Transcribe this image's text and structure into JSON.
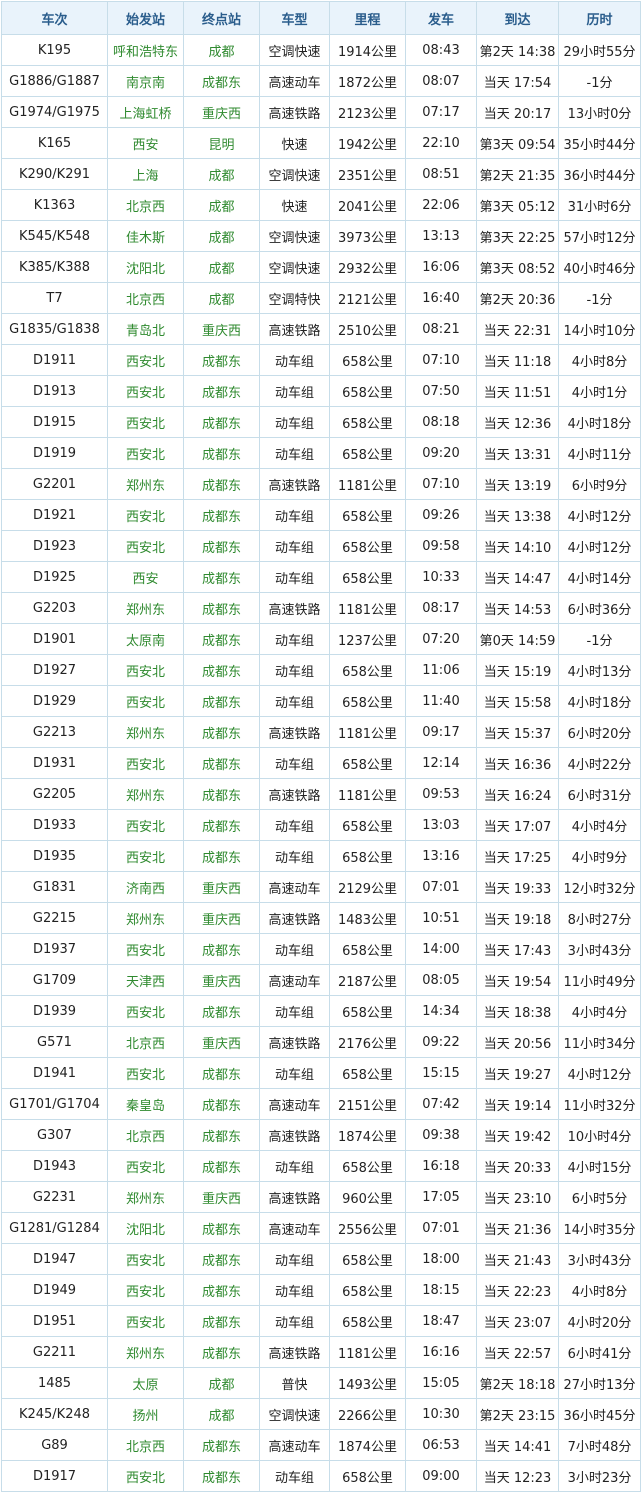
{
  "table": {
    "headers": [
      "车次",
      "始发站",
      "终点站",
      "车型",
      "里程",
      "发车",
      "到达",
      "历时"
    ],
    "rows": [
      [
        "K195",
        "呼和浩特东",
        "成都",
        "空调快速",
        "1914公里",
        "08:43",
        "第2天 14:38",
        "29小时55分"
      ],
      [
        "G1886/G1887",
        "南京南",
        "成都东",
        "高速动车",
        "1872公里",
        "08:07",
        "当天 17:54",
        "-1分"
      ],
      [
        "G1974/G1975",
        "上海虹桥",
        "重庆西",
        "高速铁路",
        "2123公里",
        "07:17",
        "当天 20:17",
        "13小时0分"
      ],
      [
        "K165",
        "西安",
        "昆明",
        "快速",
        "1942公里",
        "22:10",
        "第3天 09:54",
        "35小时44分"
      ],
      [
        "K290/K291",
        "上海",
        "成都",
        "空调快速",
        "2351公里",
        "08:51",
        "第2天 21:35",
        "36小时44分"
      ],
      [
        "K1363",
        "北京西",
        "成都",
        "快速",
        "2041公里",
        "22:06",
        "第3天 05:12",
        "31小时6分"
      ],
      [
        "K545/K548",
        "佳木斯",
        "成都",
        "空调快速",
        "3973公里",
        "13:13",
        "第3天 22:25",
        "57小时12分"
      ],
      [
        "K385/K388",
        "沈阳北",
        "成都",
        "空调快速",
        "2932公里",
        "16:06",
        "第3天 08:52",
        "40小时46分"
      ],
      [
        "T7",
        "北京西",
        "成都",
        "空调特快",
        "2121公里",
        "16:40",
        "第2天 20:36",
        "-1分"
      ],
      [
        "G1835/G1838",
        "青岛北",
        "重庆西",
        "高速铁路",
        "2510公里",
        "08:21",
        "当天 22:31",
        "14小时10分"
      ],
      [
        "D1911",
        "西安北",
        "成都东",
        "动车组",
        "658公里",
        "07:10",
        "当天 11:18",
        "4小时8分"
      ],
      [
        "D1913",
        "西安北",
        "成都东",
        "动车组",
        "658公里",
        "07:50",
        "当天 11:51",
        "4小时1分"
      ],
      [
        "D1915",
        "西安北",
        "成都东",
        "动车组",
        "658公里",
        "08:18",
        "当天 12:36",
        "4小时18分"
      ],
      [
        "D1919",
        "西安北",
        "成都东",
        "动车组",
        "658公里",
        "09:20",
        "当天 13:31",
        "4小时11分"
      ],
      [
        "G2201",
        "郑州东",
        "成都东",
        "高速铁路",
        "1181公里",
        "07:10",
        "当天 13:19",
        "6小时9分"
      ],
      [
        "D1921",
        "西安北",
        "成都东",
        "动车组",
        "658公里",
        "09:26",
        "当天 13:38",
        "4小时12分"
      ],
      [
        "D1923",
        "西安北",
        "成都东",
        "动车组",
        "658公里",
        "09:58",
        "当天 14:10",
        "4小时12分"
      ],
      [
        "D1925",
        "西安",
        "成都东",
        "动车组",
        "658公里",
        "10:33",
        "当天 14:47",
        "4小时14分"
      ],
      [
        "G2203",
        "郑州东",
        "成都东",
        "高速铁路",
        "1181公里",
        "08:17",
        "当天 14:53",
        "6小时36分"
      ],
      [
        "D1901",
        "太原南",
        "成都东",
        "动车组",
        "1237公里",
        "07:20",
        "第0天 14:59",
        "-1分"
      ],
      [
        "D1927",
        "西安北",
        "成都东",
        "动车组",
        "658公里",
        "11:06",
        "当天 15:19",
        "4小时13分"
      ],
      [
        "D1929",
        "西安北",
        "成都东",
        "动车组",
        "658公里",
        "11:40",
        "当天 15:58",
        "4小时18分"
      ],
      [
        "G2213",
        "郑州东",
        "成都东",
        "高速铁路",
        "1181公里",
        "09:17",
        "当天 15:37",
        "6小时20分"
      ],
      [
        "D1931",
        "西安北",
        "成都东",
        "动车组",
        "658公里",
        "12:14",
        "当天 16:36",
        "4小时22分"
      ],
      [
        "G2205",
        "郑州东",
        "成都东",
        "高速铁路",
        "1181公里",
        "09:53",
        "当天 16:24",
        "6小时31分"
      ],
      [
        "D1933",
        "西安北",
        "成都东",
        "动车组",
        "658公里",
        "13:03",
        "当天 17:07",
        "4小时4分"
      ],
      [
        "D1935",
        "西安北",
        "成都东",
        "动车组",
        "658公里",
        "13:16",
        "当天 17:25",
        "4小时9分"
      ],
      [
        "G1831",
        "济南西",
        "重庆西",
        "高速动车",
        "2129公里",
        "07:01",
        "当天 19:33",
        "12小时32分"
      ],
      [
        "G2215",
        "郑州东",
        "重庆西",
        "高速铁路",
        "1483公里",
        "10:51",
        "当天 19:18",
        "8小时27分"
      ],
      [
        "D1937",
        "西安北",
        "成都东",
        "动车组",
        "658公里",
        "14:00",
        "当天 17:43",
        "3小时43分"
      ],
      [
        "G1709",
        "天津西",
        "重庆西",
        "高速动车",
        "2187公里",
        "08:05",
        "当天 19:54",
        "11小时49分"
      ],
      [
        "D1939",
        "西安北",
        "成都东",
        "动车组",
        "658公里",
        "14:34",
        "当天 18:38",
        "4小时4分"
      ],
      [
        "G571",
        "北京西",
        "重庆西",
        "高速铁路",
        "2176公里",
        "09:22",
        "当天 20:56",
        "11小时34分"
      ],
      [
        "D1941",
        "西安北",
        "成都东",
        "动车组",
        "658公里",
        "15:15",
        "当天 19:27",
        "4小时12分"
      ],
      [
        "G1701/G1704",
        "秦皇岛",
        "成都东",
        "高速动车",
        "2151公里",
        "07:42",
        "当天 19:14",
        "11小时32分"
      ],
      [
        "G307",
        "北京西",
        "成都东",
        "高速铁路",
        "1874公里",
        "09:38",
        "当天 19:42",
        "10小时4分"
      ],
      [
        "D1943",
        "西安北",
        "成都东",
        "动车组",
        "658公里",
        "16:18",
        "当天 20:33",
        "4小时15分"
      ],
      [
        "G2231",
        "郑州东",
        "重庆西",
        "高速铁路",
        "960公里",
        "17:05",
        "当天 23:10",
        "6小时5分"
      ],
      [
        "G1281/G1284",
        "沈阳北",
        "成都东",
        "高速动车",
        "2556公里",
        "07:01",
        "当天 21:36",
        "14小时35分"
      ],
      [
        "D1947",
        "西安北",
        "成都东",
        "动车组",
        "658公里",
        "18:00",
        "当天 21:43",
        "3小时43分"
      ],
      [
        "D1949",
        "西安北",
        "成都东",
        "动车组",
        "658公里",
        "18:15",
        "当天 22:23",
        "4小时8分"
      ],
      [
        "D1951",
        "西安北",
        "成都东",
        "动车组",
        "658公里",
        "18:47",
        "当天 23:07",
        "4小时20分"
      ],
      [
        "G2211",
        "郑州东",
        "成都东",
        "高速铁路",
        "1181公里",
        "16:16",
        "当天 22:57",
        "6小时41分"
      ],
      [
        "1485",
        "太原",
        "成都",
        "普快",
        "1493公里",
        "15:05",
        "第2天 18:18",
        "27小时13分"
      ],
      [
        "K245/K248",
        "扬州",
        "成都",
        "空调快速",
        "2266公里",
        "10:30",
        "第2天 23:15",
        "36小时45分"
      ],
      [
        "G89",
        "北京西",
        "成都东",
        "高速动车",
        "1874公里",
        "06:53",
        "当天 14:41",
        "7小时48分"
      ],
      [
        "D1917",
        "西安北",
        "成都东",
        "动车组",
        "658公里",
        "09:00",
        "当天 12:23",
        "3小时23分"
      ]
    ]
  },
  "colors": {
    "header_bg": "#e9f3fb",
    "header_text": "#2a5d8c",
    "station_text": "#2f8a2f",
    "border": "#c7dde9",
    "body_text": "#222222"
  }
}
